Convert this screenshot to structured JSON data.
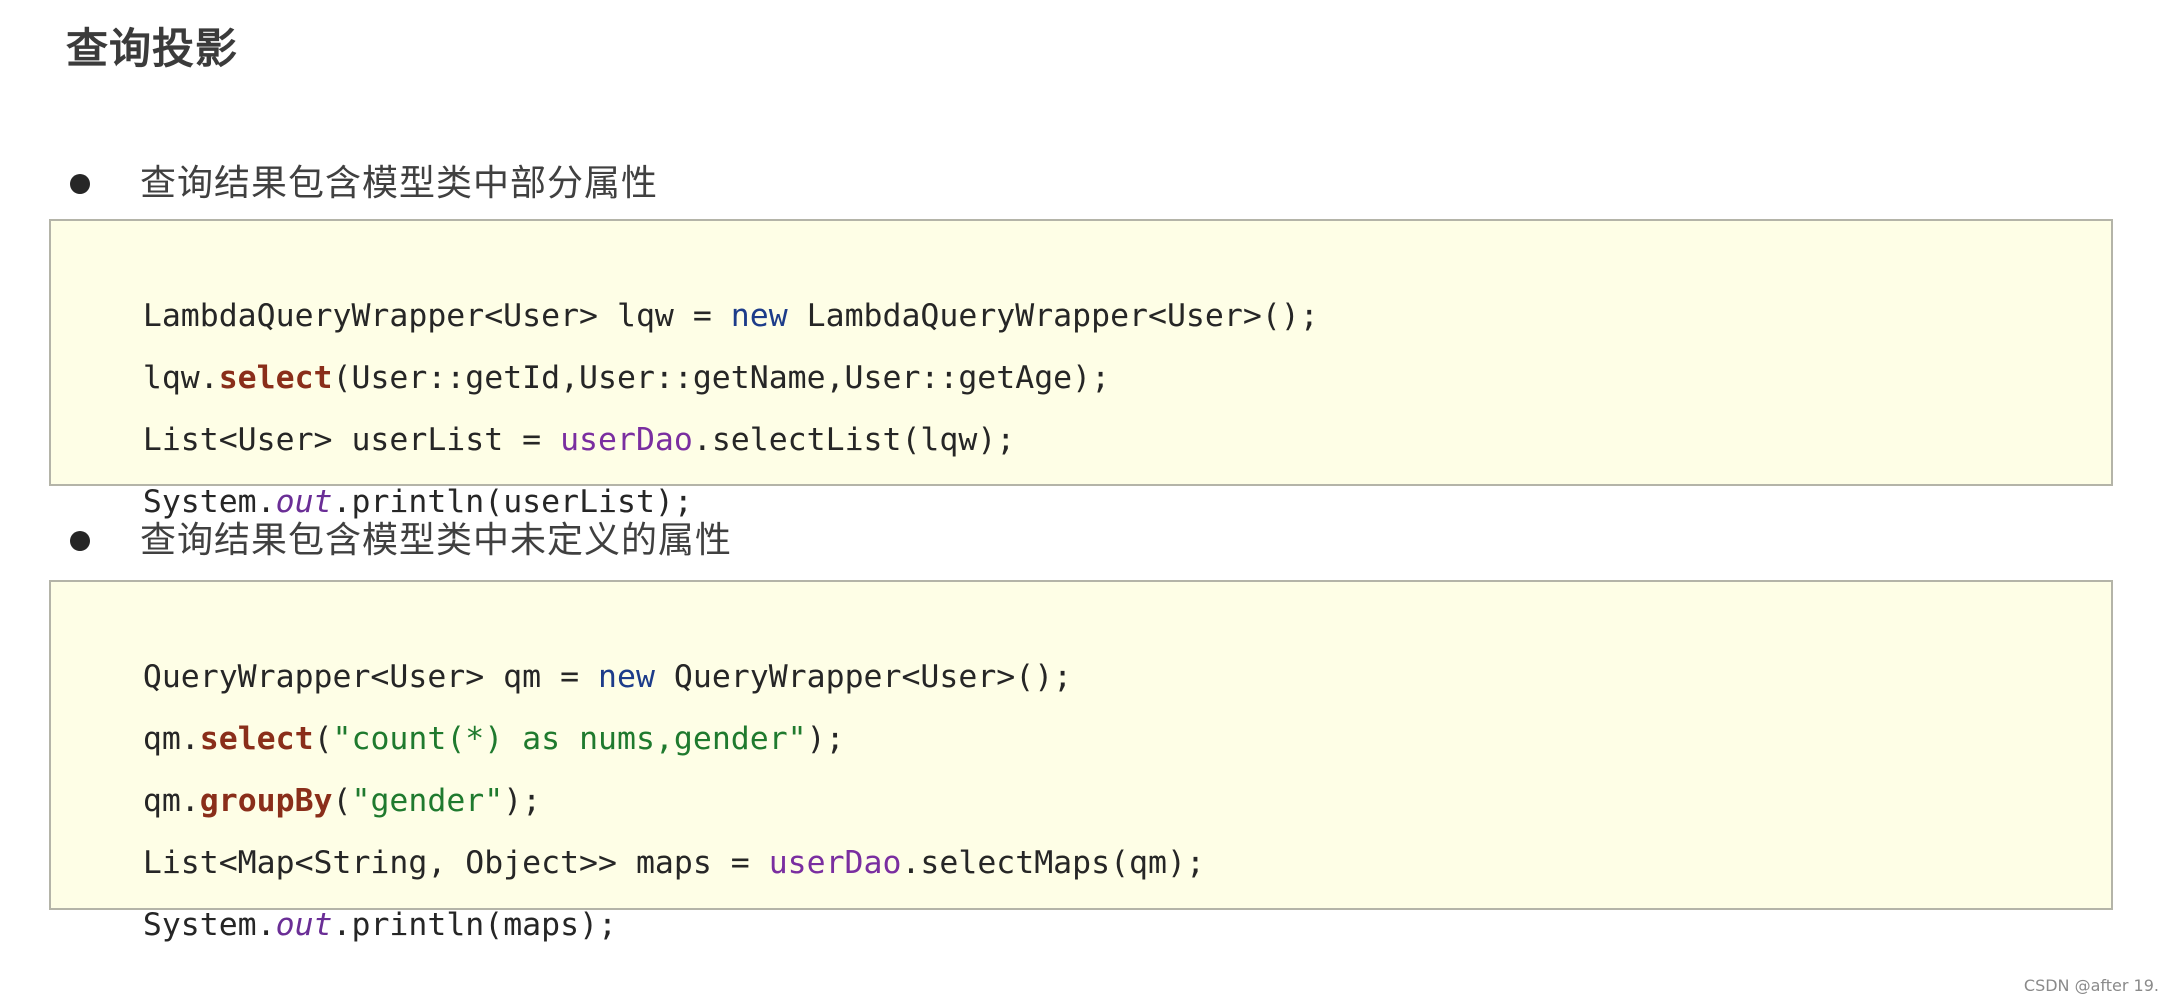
{
  "page": {
    "title": "查询投影",
    "watermark": "CSDN @after 19."
  },
  "sections": [
    {
      "heading": "查询结果包含模型类中部分属性",
      "code_lines": [
        [
          {
            "text": "LambdaQueryWrapper<User> lqw = ",
            "style": "plain"
          },
          {
            "text": "new",
            "style": "keyword"
          },
          {
            "text": " LambdaQueryWrapper<User>();",
            "style": "plain"
          }
        ],
        [
          {
            "text": "lqw.",
            "style": "plain"
          },
          {
            "text": "select",
            "style": "method"
          },
          {
            "text": "(User::getId,User::getName,User::getAge);",
            "style": "plain"
          }
        ],
        [
          {
            "text": "List<User> userList = ",
            "style": "plain"
          },
          {
            "text": "userDao",
            "style": "field"
          },
          {
            "text": ".selectList(lqw);",
            "style": "plain"
          }
        ],
        [
          {
            "text": "System.",
            "style": "plain"
          },
          {
            "text": "out",
            "style": "static"
          },
          {
            "text": ".println(userList);",
            "style": "plain"
          }
        ]
      ]
    },
    {
      "heading": "查询结果包含模型类中未定义的属性",
      "code_lines": [
        [
          {
            "text": "QueryWrapper<User> qm = ",
            "style": "plain"
          },
          {
            "text": "new",
            "style": "keyword"
          },
          {
            "text": " QueryWrapper<User>();",
            "style": "plain"
          }
        ],
        [
          {
            "text": "qm.",
            "style": "plain"
          },
          {
            "text": "select",
            "style": "method"
          },
          {
            "text": "(",
            "style": "plain"
          },
          {
            "text": "\"count(*) as nums,gender\"",
            "style": "string"
          },
          {
            "text": ");",
            "style": "plain"
          }
        ],
        [
          {
            "text": "qm.",
            "style": "plain"
          },
          {
            "text": "groupBy",
            "style": "method"
          },
          {
            "text": "(",
            "style": "plain"
          },
          {
            "text": "\"gender\"",
            "style": "string"
          },
          {
            "text": ");",
            "style": "plain"
          }
        ],
        [
          {
            "text": "List<Map<String, Object>> maps = ",
            "style": "plain"
          },
          {
            "text": "userDao",
            "style": "field"
          },
          {
            "text": ".selectMaps(qm);",
            "style": "plain"
          }
        ],
        [
          {
            "text": "System.",
            "style": "plain"
          },
          {
            "text": "out",
            "style": "static"
          },
          {
            "text": ".println(maps);",
            "style": "plain"
          }
        ]
      ]
    }
  ]
}
